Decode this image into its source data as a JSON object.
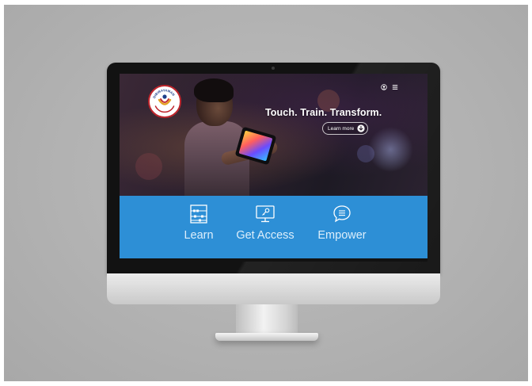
{
  "hero": {
    "headline": "Touch. Train. Transform.",
    "cta_label": "Learn more",
    "logo_text": "DIBIBAYAMAN"
  },
  "features": [
    {
      "label": "Learn",
      "icon": "abacus-icon"
    },
    {
      "label": "Get Access",
      "icon": "monitor-key-icon"
    },
    {
      "label": "Empower",
      "icon": "chat-bubble-icon"
    }
  ],
  "header_icons": [
    "globe-icon",
    "menu-icon"
  ],
  "colors": {
    "accent_blue": "#2d8fd6",
    "hero_dark": "#2a1f2c",
    "logo_red": "#c0262d"
  }
}
